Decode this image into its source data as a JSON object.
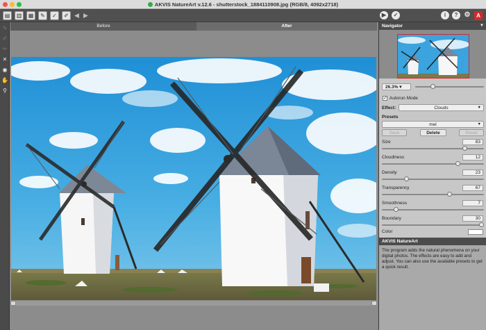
{
  "window": {
    "title": "AKVIS NatureArt v.12.6 - shutterstock_1884110908.jpg (RGB/8, 4092x2718)"
  },
  "tabs": {
    "before": "Before",
    "after": "After"
  },
  "navigator": {
    "header": "Navigator",
    "zoom": "26.3%"
  },
  "settings": {
    "autorun_label": "Autorun Mode",
    "autorun_checked": true,
    "effect_label": "Effect:",
    "effect_value": "Clouds",
    "presets_label": "Presets",
    "preset_value": "mel",
    "save_label": "Save",
    "delete_label": "Delete",
    "reset_label": "Reset",
    "params": [
      {
        "label": "Size",
        "value": "83",
        "level": 0.83
      },
      {
        "label": "Cloudiness",
        "value": "12",
        "level": 0.76
      },
      {
        "label": "Density",
        "value": "23",
        "level": 0.23
      },
      {
        "label": "Transparency",
        "value": "67",
        "level": 0.67
      },
      {
        "label": "Smoothness",
        "value": "7",
        "level": 0.12
      },
      {
        "label": "Boundary",
        "value": "30",
        "level": 1.0
      }
    ],
    "color_label": "Color",
    "color_value": "#ffffff"
  },
  "help": {
    "title": "AKVIS NatureArt",
    "text": "The program adds the natural phenomena on your digital photos. The effects are easy to add and adjust. You can also use the available presets to get a quick result."
  },
  "icons": {
    "toolbar": [
      "open-icon",
      "save-icon",
      "save-as-icon",
      "print-icon",
      "share-icon",
      "batch-icon",
      "undo-icon",
      "redo-icon",
      "run-icon",
      "apply-icon",
      "info-icon",
      "help-icon",
      "settings-icon",
      "akvis-icon"
    ],
    "tools": [
      "brush-icon",
      "eraser-icon",
      "blur-icon",
      "transform-icon",
      "eyedropper-icon",
      "hand-icon",
      "zoom-icon"
    ]
  },
  "colors": {
    "panel": "#c7c7c7",
    "toolbar": "#505050",
    "accent_red": "#d22a2a",
    "sky": "#3ba3dd"
  }
}
